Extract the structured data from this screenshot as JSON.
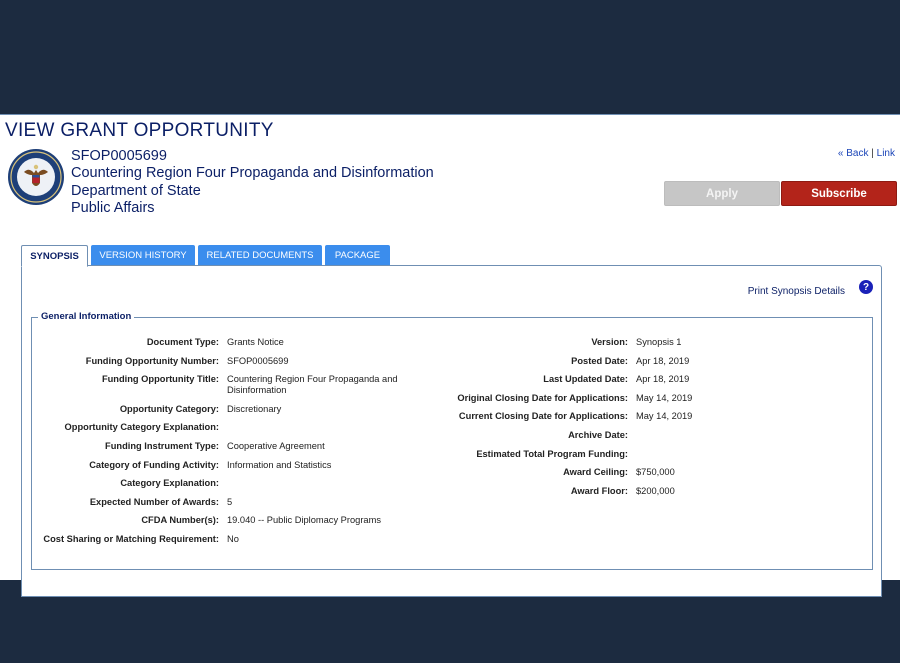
{
  "page": {
    "title": "VIEW GRANT OPPORTUNITY"
  },
  "header": {
    "opportunity_number": "SFOP0005699",
    "opportunity_title": "Countering Region Four Propaganda and Disinformation",
    "agency": "Department of State",
    "office": "Public Affairs",
    "seal_icon": "department-of-state-seal-icon"
  },
  "top_links": {
    "back": "« Back",
    "separator": "|",
    "link": "Link"
  },
  "buttons": {
    "apply": "Apply",
    "subscribe": "Subscribe"
  },
  "colors": {
    "navy_text": "#0b1f66",
    "tab_blue": "#3b8ded",
    "subscribe_red": "#b3241a",
    "apply_gray": "#c6c6c6",
    "background": "#1c2b40"
  },
  "tabs": [
    {
      "label": "SYNOPSIS",
      "active": true
    },
    {
      "label": "VERSION HISTORY",
      "active": false
    },
    {
      "label": "RELATED DOCUMENTS",
      "active": false
    },
    {
      "label": "PACKAGE",
      "active": false
    }
  ],
  "panel": {
    "print_link": "Print Synopsis Details",
    "help_icon": "?",
    "section_title": "General Information"
  },
  "left_fields": [
    {
      "label": "Document Type:",
      "value": "Grants Notice"
    },
    {
      "label": "Funding Opportunity Number:",
      "value": "SFOP0005699"
    },
    {
      "label": "Funding Opportunity Title:",
      "value": "Countering Region Four Propaganda and Disinformation"
    },
    {
      "label": "Opportunity Category:",
      "value": "Discretionary"
    },
    {
      "label": "Opportunity Category Explanation:",
      "value": ""
    },
    {
      "label": "Funding Instrument Type:",
      "value": "Cooperative Agreement"
    },
    {
      "label": "Category of Funding Activity:",
      "value": "Information and Statistics"
    },
    {
      "label": "Category Explanation:",
      "value": ""
    },
    {
      "label": "Expected Number of Awards:",
      "value": "5"
    },
    {
      "label": "CFDA Number(s):",
      "value": "19.040 -- Public Diplomacy Programs"
    },
    {
      "label": "Cost Sharing or Matching Requirement:",
      "value": "No"
    }
  ],
  "right_fields": [
    {
      "label": "Version:",
      "value": "Synopsis 1"
    },
    {
      "label": "Posted Date:",
      "value": "Apr 18, 2019"
    },
    {
      "label": "Last Updated Date:",
      "value": "Apr 18, 2019"
    },
    {
      "label": "Original Closing Date for Applications:",
      "value": "May 14, 2019"
    },
    {
      "label": "Current Closing Date for Applications:",
      "value": "May 14, 2019"
    },
    {
      "label": "Archive Date:",
      "value": ""
    },
    {
      "label": "Estimated Total Program Funding:",
      "value": ""
    },
    {
      "label": "Award Ceiling:",
      "value": "$750,000"
    },
    {
      "label": "Award Floor:",
      "value": "$200,000"
    }
  ]
}
